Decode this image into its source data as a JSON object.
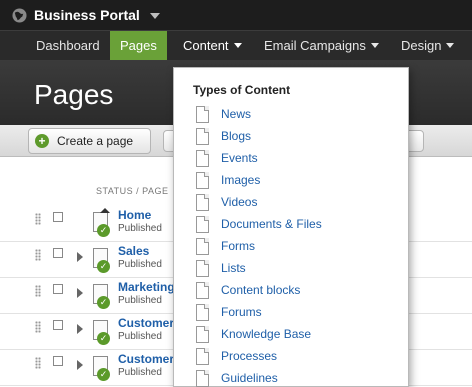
{
  "topbar": {
    "brand": "Business Portal"
  },
  "nav": {
    "items": [
      {
        "label": "Dashboard"
      },
      {
        "label": "Pages"
      },
      {
        "label": "Content"
      },
      {
        "label": "Email Campaigns"
      },
      {
        "label": "Design"
      }
    ]
  },
  "header": {
    "title": "Pages"
  },
  "toolbar": {
    "create_label": "Create a page"
  },
  "table": {
    "column_header": "STATUS / PAGE",
    "rows": [
      {
        "name": "Home",
        "status": "Published"
      },
      {
        "name": "Sales",
        "status": "Published"
      },
      {
        "name": "Marketing",
        "status": "Published"
      },
      {
        "name": "Customer",
        "status": "Published"
      },
      {
        "name": "Customer",
        "status": "Published"
      }
    ]
  },
  "dropdown": {
    "title": "Types of Content",
    "items": [
      "News",
      "Blogs",
      "Events",
      "Images",
      "Videos",
      "Documents & Files",
      "Forms",
      "Lists",
      "Content blocks",
      "Forums",
      "Knowledge Base",
      "Processes",
      "Guidelines"
    ]
  },
  "colors": {
    "active_nav": "#6aa138",
    "link": "#1f5fa8",
    "published_check": "#5b9a2a"
  }
}
